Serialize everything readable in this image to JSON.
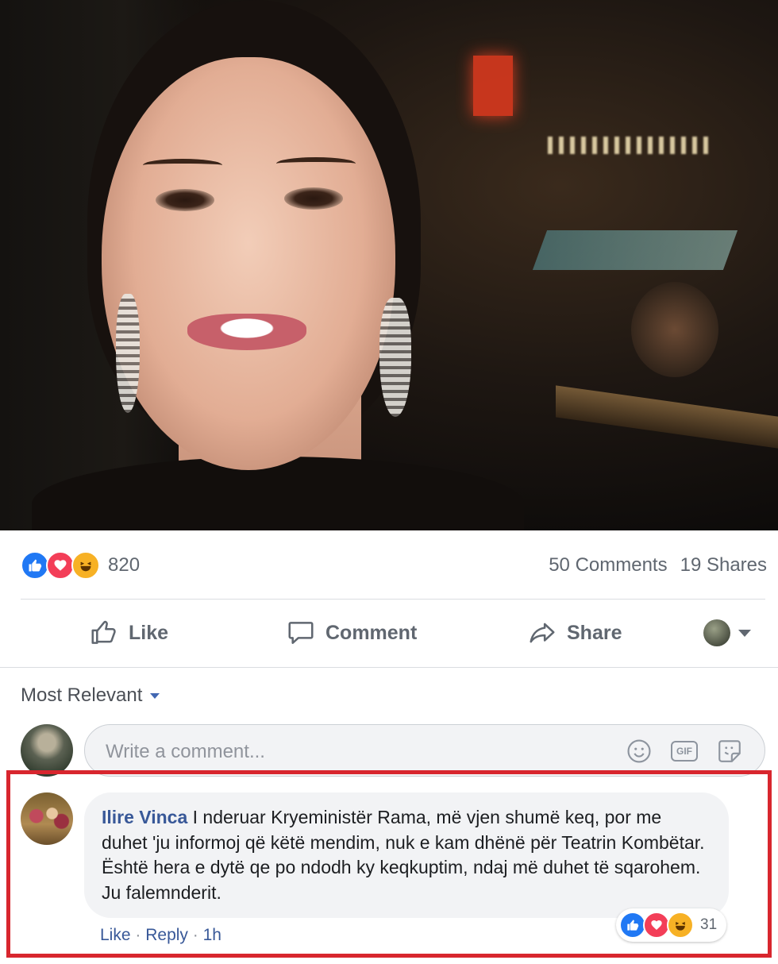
{
  "post": {
    "reactions": {
      "icons": [
        "like-icon",
        "love-icon",
        "haha-icon"
      ],
      "count": "820"
    },
    "comments_count": "50 Comments",
    "shares_count": "19 Shares"
  },
  "actions": {
    "like": "Like",
    "comment": "Comment",
    "share": "Share"
  },
  "comments_section": {
    "sort_label": "Most Relevant",
    "composer_placeholder": "Write a comment...",
    "composer_icons": [
      "emoji-icon",
      "gif-icon",
      "sticker-icon"
    ],
    "gif_text": "GIF"
  },
  "comment": {
    "author": "Ilire Vinca",
    "text": "I nderuar Kryeministër Rama, më vjen shumë keq, por me duhet 'ju informoj që këtë mendim, nuk e kam dhënë për Teatrin Kombëtar. Është hera e dytë qe po ndodh ky keqkuptim, ndaj më duhet të sqarohem. Ju falemnderit.",
    "reaction_count": "31",
    "like_link": "Like",
    "reply_link": "Reply",
    "separator": "·",
    "time": "1h"
  },
  "colors": {
    "link_blue": "#385898",
    "highlight_red": "#d8262e",
    "like_blue": "#2078f4",
    "love_red": "#f33e58",
    "haha_yellow": "#f7b125"
  }
}
